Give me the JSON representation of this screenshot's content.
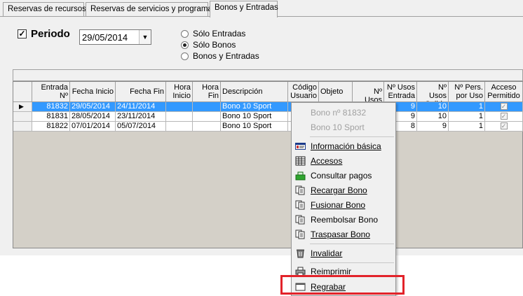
{
  "tabs": [
    {
      "label": "Reservas de recursos"
    },
    {
      "label": "Reservas de servicios y programas"
    },
    {
      "label": "Bonos y Entradas"
    }
  ],
  "filter": {
    "periodo_label": "Periodo",
    "periodo_checked": true,
    "date_value": "29/05/2014",
    "radios": [
      {
        "label": "Sólo Entradas",
        "selected": false
      },
      {
        "label": "Sólo Bonos",
        "selected": true
      },
      {
        "label": "Bonos y Entradas",
        "selected": false
      }
    ]
  },
  "table": {
    "columns": [
      "Entrada Nº",
      "Fecha Inicio",
      "Fecha Fin",
      "Hora Inicio",
      "Hora Fin",
      "Descripción",
      "Código Usuario",
      "Objeto",
      "Nº Usos",
      "Nº Usos Entrada",
      "Nº Usos Salida",
      "Nº Pers. por Uso",
      "Acceso Permitido"
    ],
    "rows": [
      {
        "entrada": "81832",
        "fecha_inicio": "29/05/2014",
        "fecha_fin": "24/11/2014",
        "hora_inicio": "",
        "hora_fin": "",
        "descripcion": "Bono 10 Sport",
        "usos_entrada": "9",
        "usos_salida": "10",
        "pers": "1",
        "acceso": true,
        "selected": true
      },
      {
        "entrada": "81831",
        "fecha_inicio": "28/05/2014",
        "fecha_fin": "23/11/2014",
        "hora_inicio": "",
        "hora_fin": "",
        "descripcion": "Bono 10 Sport",
        "usos_entrada": "9",
        "usos_salida": "10",
        "pers": "1",
        "acceso": true,
        "selected": false
      },
      {
        "entrada": "81822",
        "fecha_inicio": "07/01/2014",
        "fecha_fin": "05/07/2014",
        "hora_inicio": "",
        "hora_fin": "",
        "descripcion": "Bono 10 Sport",
        "usos_entrada": "8",
        "usos_salida": "9",
        "pers": "1",
        "acceso": true,
        "selected": false
      }
    ]
  },
  "context_menu": {
    "header_items": [
      "Bono nº 81832",
      "Bono 10 Sport"
    ],
    "items": [
      {
        "label": "Información básica",
        "icon": "id-card-icon"
      },
      {
        "label": "Accesos",
        "icon": "grid-table-icon"
      },
      {
        "label": "Consultar pagos",
        "icon": "cash-register-icon"
      },
      {
        "label": "Recargar Bono",
        "icon": "documents-icon"
      },
      {
        "label": "Fusionar Bono",
        "icon": "documents-icon"
      },
      {
        "label": "Reembolsar Bono",
        "icon": "documents-icon"
      },
      {
        "label": "Traspasar Bono",
        "icon": "documents-icon"
      },
      {
        "label": "Invalidar",
        "icon": "trash-bin-icon"
      },
      {
        "label": "Reimprimir",
        "icon": "printer-icon"
      },
      {
        "label": "Regrabar",
        "icon": "card-reader-icon"
      }
    ]
  },
  "colors": {
    "selection": "#3399ff",
    "highlight_box": "#e2232a"
  }
}
